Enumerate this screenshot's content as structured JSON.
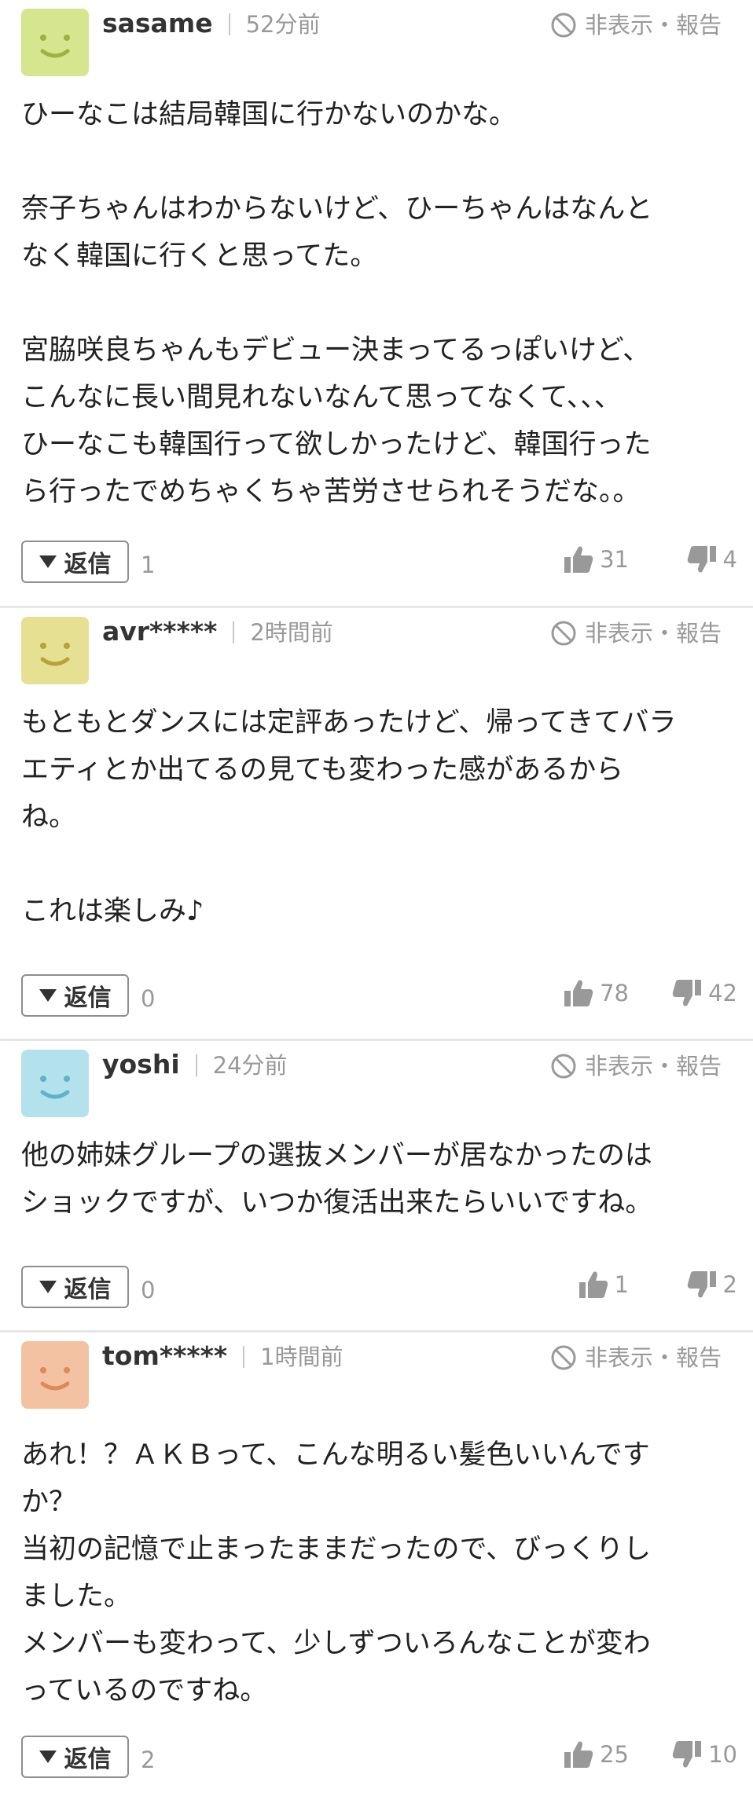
{
  "colors": {
    "accent_gray": "#999999",
    "divider": "#e6e6e6",
    "avatar_green": "#d6e68f",
    "avatar_yellow": "#e6e093",
    "avatar_blue": "#b4e2ec",
    "avatar_orange": "#f3c2a2"
  },
  "icons": {
    "avatar": "smiley-face-icon",
    "hide": "no-entry-icon",
    "reply": "triangle-down-icon",
    "like": "thumbs-up-icon",
    "dislike": "thumbs-down-icon"
  },
  "comments": [
    {
      "username": "sasame",
      "time": "52分前",
      "hide_report": "非表示・報告",
      "body": "ひーなこは結局韓国に行かないのかな。\n\n奈子ちゃんはわからないけど、ひーちゃんはなんと\nなく韓国に行くと思ってた。\n\n宮脇咲良ちゃんもデビュー決まってるっぽいけど、\nこんなに長い間見れないなんて思ってなくて、、、\nひーなこも韓国行って欲しかったけど、韓国行った\nら行ったでめちゃくちゃ苦労させられそうだな。。",
      "reply_label": "返信",
      "reply_count": "1",
      "likes": "31",
      "dislikes": "4"
    },
    {
      "username": "avr*****",
      "time": "2時間前",
      "hide_report": "非表示・報告",
      "body": "もともとダンスには定評あったけど、帰ってきてバラ\nエティとか出てるの見ても変わった感があるから\nね。\n\nこれは楽しみ♪",
      "reply_label": "返信",
      "reply_count": "0",
      "likes": "78",
      "dislikes": "42"
    },
    {
      "username": "yoshi",
      "time": "24分前",
      "hide_report": "非表示・報告",
      "body": "他の姉妹グループの選抜メンバーが居なかったのは\nショックですが、いつか復活出来たらいいですね。",
      "reply_label": "返信",
      "reply_count": "0",
      "likes": "1",
      "dislikes": "2"
    },
    {
      "username": "tom*****",
      "time": "1時間前",
      "hide_report": "非表示・報告",
      "body": "あれ！？ＡＫＢって、こんな明るい髪色いいんです\nか？\n当初の記憶で止まったままだったので、びっくりし\nました。\nメンバーも変わって、少しずついろんなことが変わ\nっているのですね。",
      "reply_label": "返信",
      "reply_count": "2",
      "likes": "25",
      "dislikes": "10"
    }
  ]
}
